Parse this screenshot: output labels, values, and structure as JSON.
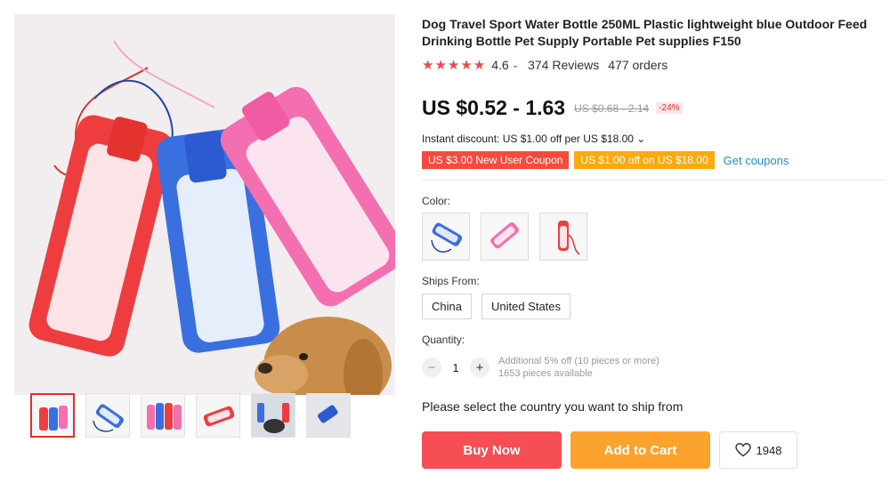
{
  "product": {
    "title": "Dog Travel Sport Water Bottle 250ML Plastic lightweight blue Outdoor Feed Drinking Bottle Pet Supply Portable Pet supplies F150",
    "rating_stars": "★★★★★",
    "rating_value": "4.6",
    "rating_chevron": "⌄",
    "reviews": "374 Reviews",
    "orders": "477 orders"
  },
  "price": {
    "current": "US $0.52 - 1.63",
    "original": "US $0.68 - 2.14",
    "discount": "-24%",
    "instant_discount": "Instant discount: US $1.00 off per US $18.00 ⌄"
  },
  "coupons": {
    "items": [
      {
        "label": "US $3.00 New User Coupon",
        "color": "#f64a3c"
      },
      {
        "label": "US $1.00 off on US $18.00",
        "color": "#fbaa10"
      }
    ],
    "get_link": "Get coupons"
  },
  "color": {
    "label": "Color:",
    "options": [
      "blue",
      "pink",
      "red"
    ]
  },
  "ships_from": {
    "label": "Ships From:",
    "options": [
      "China",
      "United States"
    ]
  },
  "quantity": {
    "label": "Quantity:",
    "minus": "−",
    "plus": "+",
    "value": "1",
    "note_line1": "Additional 5% off (10 pieces or more)",
    "note_line2": "1653 pieces available"
  },
  "ship_prompt": "Please select the country you want to ship from",
  "actions": {
    "buy_now": "Buy Now",
    "add_to_cart": "Add to Cart",
    "wishlist_count": "1948"
  },
  "colors": {
    "accent_red": "#f64e54",
    "accent_orange": "#fba32c",
    "link_blue": "#1a8fc9"
  }
}
